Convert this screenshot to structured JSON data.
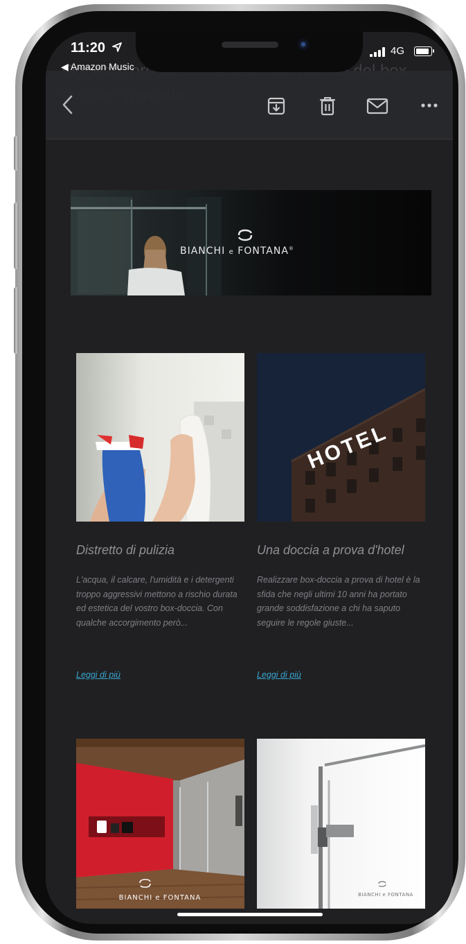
{
  "status_bar": {
    "time": "11:20",
    "back_app": "◀ Amazon Music",
    "network": "4G"
  },
  "email": {
    "subject_partial": "Oggetto, prodotti e curiosità dal mondo del box doccia - gennaio",
    "banner": {
      "brand": "BIANCHI",
      "brand_joiner": "e",
      "brand_second": "FONTANA"
    },
    "articles": [
      {
        "title": "Distretto di pulizia",
        "description": "L'acqua, il calcare, l'umidità e i detergenti troppo aggressivi mettono a rischio durata ed estetica del vostro box-doccia. Con qualche accorgimento però...",
        "link": "Leggi di più"
      },
      {
        "title": "Una doccia a prova d'hotel",
        "description": "Realizzare box-doccia a prova di hotel è la sfida che negli ultimi 10 anni ha portato grande soddisfazione a chi ha saputo seguire le regole giuste...",
        "link": "Leggi di più",
        "image_sign": "HOTEL"
      }
    ],
    "bottom_cards": [
      {
        "logo_text": "BIANCHI e FONTANA"
      },
      {
        "logo_text": "BIANCHI e FONTANA"
      }
    ]
  },
  "colors": {
    "background": "#202022",
    "link": "#38a6cf",
    "title": "#8f9094",
    "text": "#7f8085"
  }
}
